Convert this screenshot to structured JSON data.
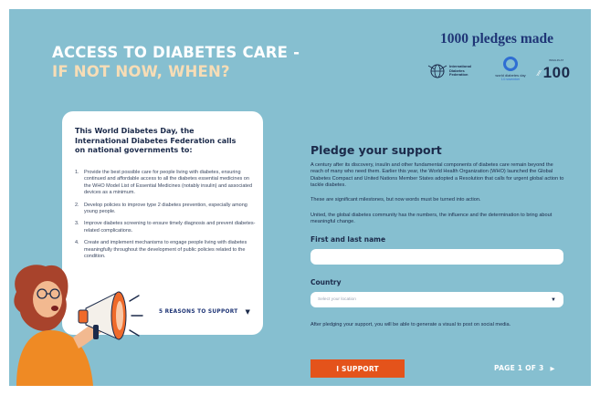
{
  "header": {
    "title_line1": "ACCESS TO DIABETES CARE -",
    "title_line2": "IF NOT NOW, WHEN?",
    "pledges_count": "1000 pledges made"
  },
  "logos": {
    "idf_text": [
      "International",
      "Diabetes",
      "Federation"
    ],
    "wdd_text": "world diabetes day",
    "wdd_sub": "14 november",
    "insulin_caption": "INSULIN AT",
    "insulin_number": "100"
  },
  "card": {
    "heading": "This World Diabetes Day, the International Diabetes Federation calls on national governments to:",
    "items": [
      {
        "n": "1.",
        "text": "Provide the best possible care for people living with diabetes, ensuring continued and affordable access to all the diabetes essential medicines on the WHO Model List of Essential Medicines (notably insulin) and associated devices as a minimum."
      },
      {
        "n": "2.",
        "text": "Develop policies to improve type 2 diabetes prevention, especially among young people."
      },
      {
        "n": "3.",
        "text": "Improve diabetes screening to ensure timely diagnosis and prevent diabetes-related complications."
      },
      {
        "n": "4.",
        "text": "Create and implement mechanisms to engage people living with diabetes meaningfully throughout the development of public policies related to the condition."
      }
    ],
    "reasons_label": "5 REASONS TO SUPPORT",
    "reasons_arrow": "▼"
  },
  "form": {
    "title": "Pledge your support",
    "para1": "A century after its discovery, insulin and other fundamental components of diabetes care remain beyond the reach of many who need them. Earlier this year, the World Health Organization (WHO) launched the Global Diabetes Compact and United Nations Member States adopted a Resolution that calls for urgent global action to tackle diabetes.",
    "para2": "These are significant milestones, but now words must be turned into action.",
    "para3": "United, the global diabetes community has the numbers, the influence and the determination to bring about meaningful change.",
    "name_label": "First and last name",
    "name_value": "",
    "country_label": "Country",
    "country_placeholder": "Select your location",
    "country_arrow": "▼",
    "after_text": "After pledging your support, you will be able to generate a visual to post on social media.",
    "submit_label": "I SUPPORT"
  },
  "pagination": {
    "label": "PAGE 1 OF 3",
    "next_arrow": "▶"
  },
  "colors": {
    "background": "#86bfd0",
    "navy": "#1b2a4a",
    "accent_orange": "#e4531b",
    "title_peach": "#f7ddb6"
  }
}
